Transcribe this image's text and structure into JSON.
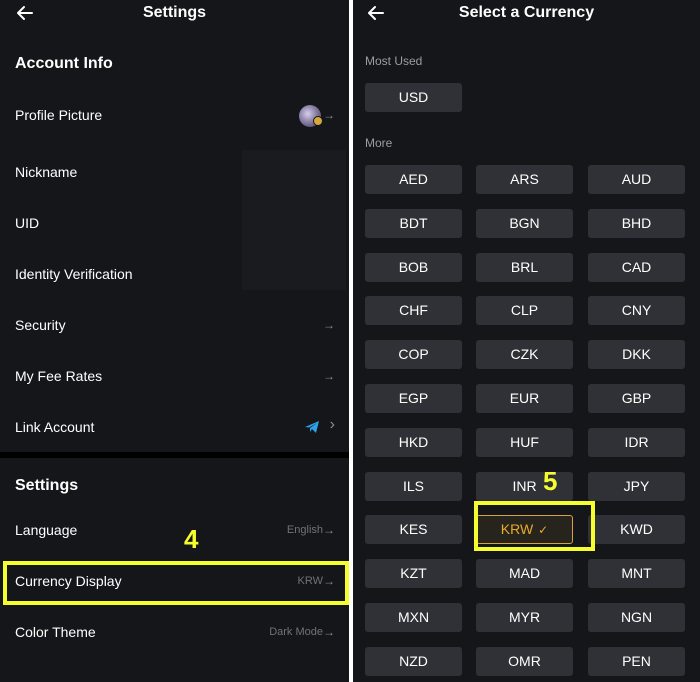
{
  "settings_screen": {
    "title": "Settings",
    "account_section_title": "Account Info",
    "rows": {
      "profile_picture": "Profile Picture",
      "nickname": "Nickname",
      "uid": "UID",
      "identity_verification": "Identity Verification",
      "security": "Security",
      "fee_rates": "My Fee Rates",
      "link_account": "Link Account"
    },
    "settings_section_title": "Settings",
    "language": {
      "label": "Language",
      "value": "English"
    },
    "currency_display": {
      "label": "Currency Display",
      "value": "KRW"
    },
    "color_theme": {
      "label": "Color Theme",
      "value": "Dark Mode"
    },
    "arrow": "→",
    "chevron": "›"
  },
  "currency_screen": {
    "title": "Select a Currency",
    "most_used_label": "Most Used",
    "most_used": [
      "USD"
    ],
    "more_label": "More",
    "currencies": [
      "AED",
      "ARS",
      "AUD",
      "BDT",
      "BGN",
      "BHD",
      "BOB",
      "BRL",
      "CAD",
      "CHF",
      "CLP",
      "CNY",
      "COP",
      "CZK",
      "DKK",
      "EGP",
      "EUR",
      "GBP",
      "HKD",
      "HUF",
      "IDR",
      "ILS",
      "INR",
      "JPY",
      "KES",
      "KRW",
      "KWD",
      "KZT",
      "MAD",
      "MNT",
      "MXN",
      "MYR",
      "NGN",
      "NZD",
      "OMR",
      "PEN"
    ],
    "selected": "KRW",
    "check_mark": "✓"
  },
  "annotations": {
    "step4": "4",
    "step5": "5"
  },
  "colors": {
    "background": "#151619",
    "button": "#2f3136",
    "selected_accent": "#d8a33a",
    "annotation_highlight": "#f6ff2e",
    "telegram_blue": "#2aa3e8"
  },
  "icons": {
    "back": "arrow-left-icon",
    "row_arrow": "arrow-right-icon",
    "chevron": "chevron-right-icon",
    "telegram": "telegram-icon",
    "avatar": "avatar-image"
  }
}
